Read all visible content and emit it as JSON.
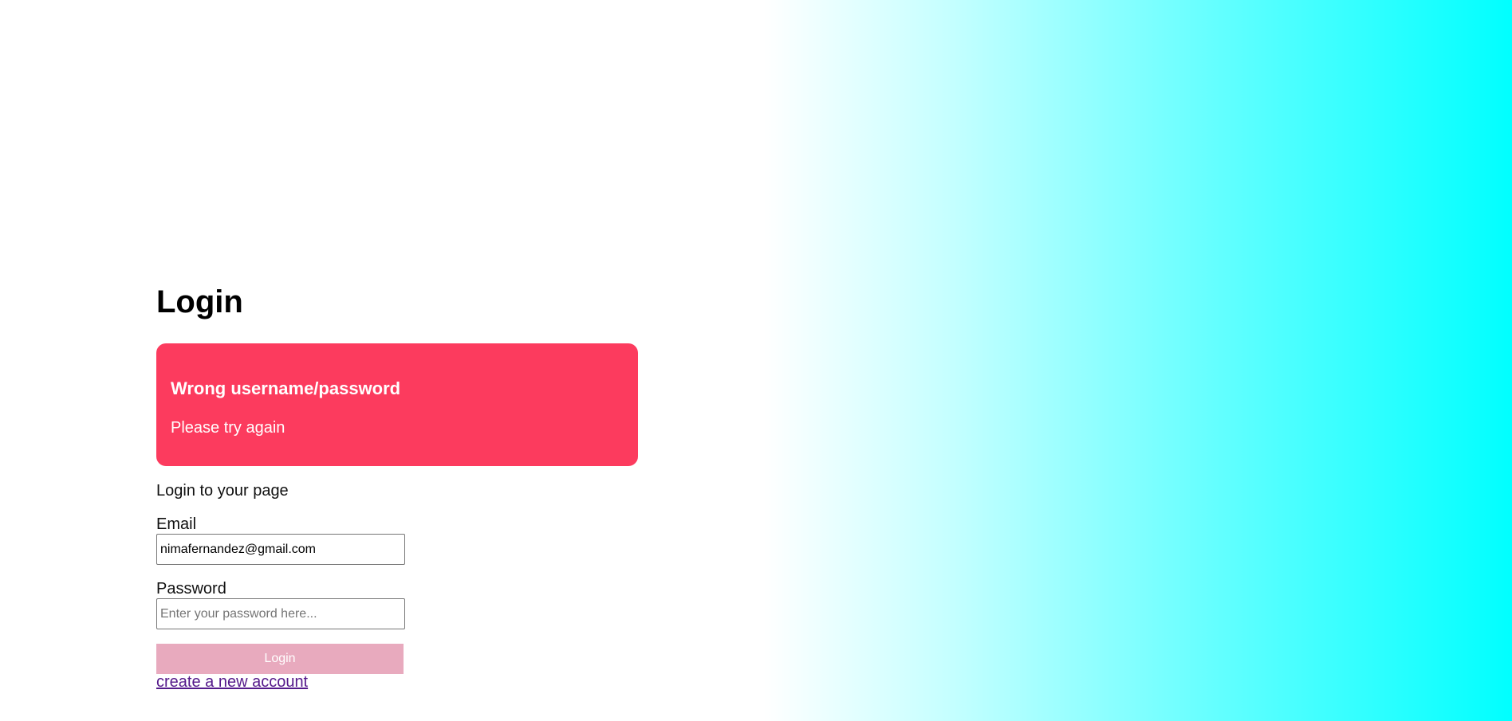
{
  "theme": {
    "alert_bg": "#fc3b5e",
    "button_bg": "#e8aabe",
    "link_color": "#551a8b",
    "gradient_end": "#00ffff"
  },
  "page": {
    "title": "Login"
  },
  "alert": {
    "title": "Wrong username/password",
    "message": "Please try again"
  },
  "form": {
    "subtitle": "Login to your page",
    "email": {
      "label": "Email",
      "value": "nimafernandez@gmail.com",
      "placeholder": ""
    },
    "password": {
      "label": "Password",
      "value": "",
      "placeholder": "Enter your password here..."
    },
    "submit_label": "Login",
    "create_account_link": "create a new account"
  }
}
